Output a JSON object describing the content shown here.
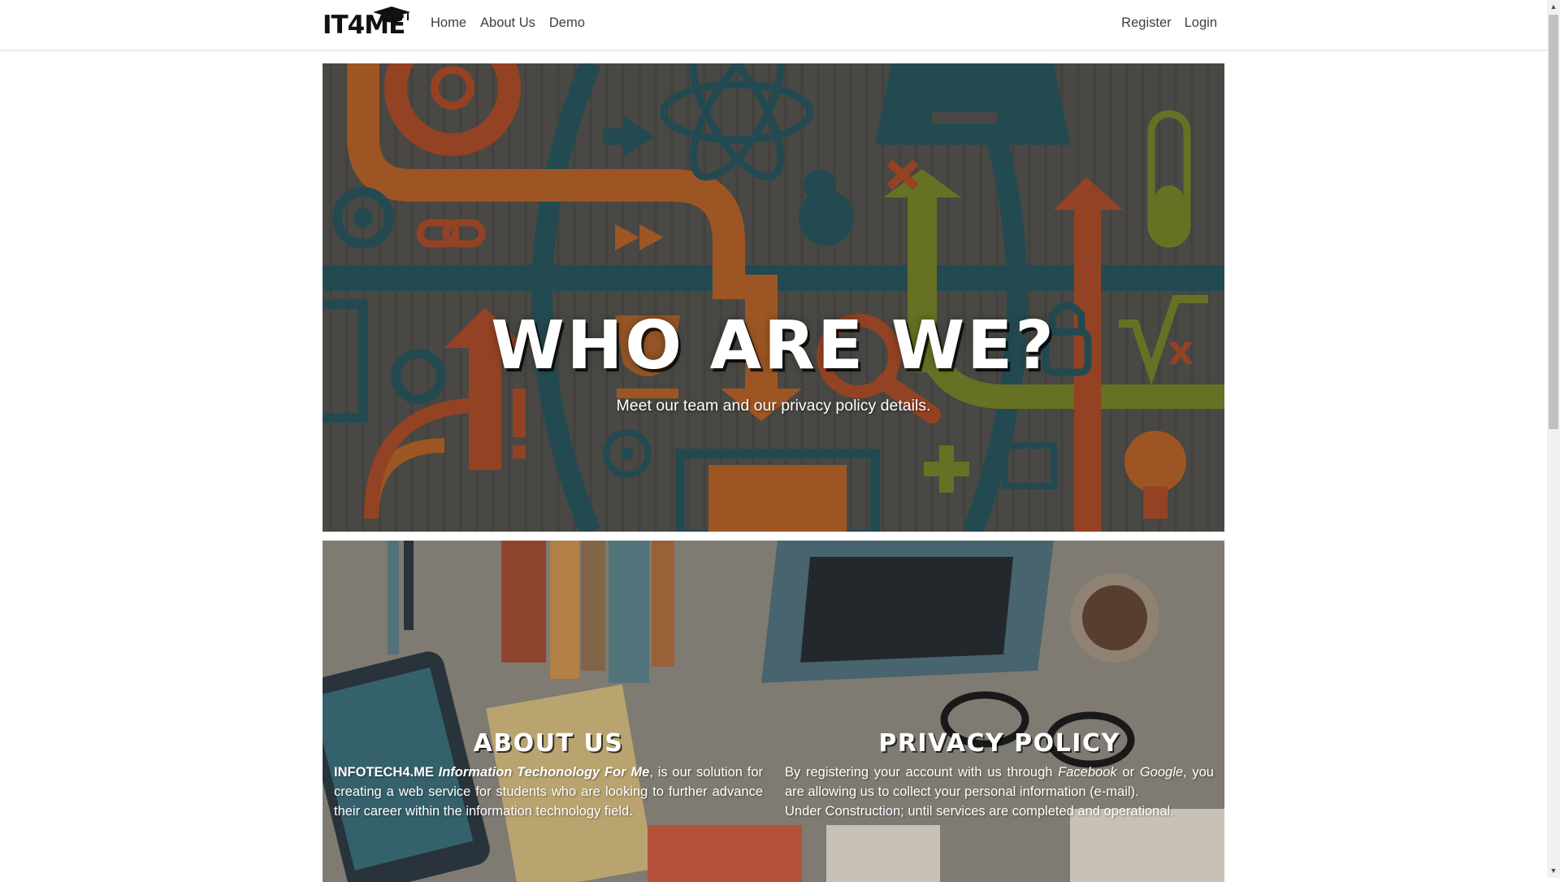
{
  "navbar": {
    "brand": "IT4ME",
    "left_links": [
      "Home",
      "About Us",
      "Demo"
    ],
    "right_links": [
      "Register",
      "Login"
    ]
  },
  "hero": {
    "title": "WHO ARE WE?",
    "subtitle": "Meet our team and our privacy policy details."
  },
  "about": {
    "heading": "ABOUT US",
    "brand_name": "INFOTECH4.ME",
    "brand_expansion": "Information Techonology For Me",
    "text": ", is our solution for creating a web service for students who are looking to further advance their career within the information technology field."
  },
  "privacy": {
    "heading": "PRIVACY POLICY",
    "text_1": "By registering your account with us through ",
    "facebook": "Facebook",
    "or": " or ",
    "google": "Google",
    "text_2": ", you are allowing us to collect your personal information (e-mail).",
    "note": "Under Construction; until services are completed and operational."
  },
  "colors": {
    "orange": "#c06a2b",
    "teal": "#2b5b63",
    "olive": "#7d8a2d",
    "rust": "#b5512c"
  },
  "icons": [
    "graduation-cap-icon",
    "scroll-up-arrow-icon",
    "scroll-down-arrow-icon"
  ]
}
